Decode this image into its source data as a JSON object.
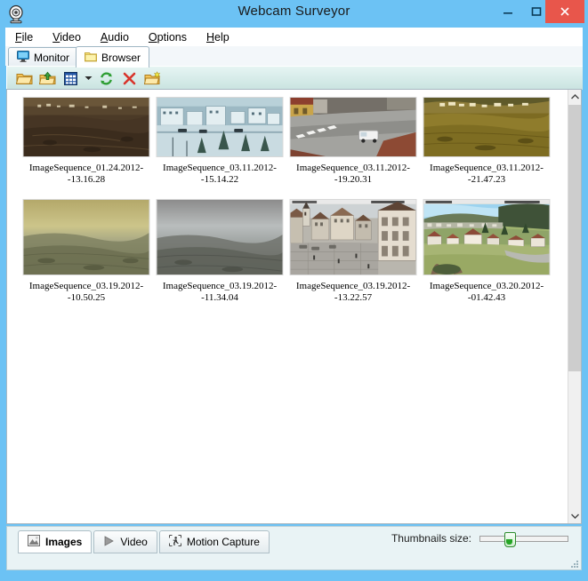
{
  "window": {
    "title": "Webcam Surveyor",
    "app_icon": "webcam-icon",
    "titlebar_color": "#6cc2f4",
    "controls": {
      "minimize": "minimize-icon",
      "maximize": "maximize-icon",
      "close": "close-icon",
      "close_color": "#e8564b"
    }
  },
  "menubar": {
    "items": [
      {
        "label": "File",
        "accel": "F"
      },
      {
        "label": "Video",
        "accel": "V"
      },
      {
        "label": "Audio",
        "accel": "A"
      },
      {
        "label": "Options",
        "accel": "O"
      },
      {
        "label": "Help",
        "accel": "H"
      }
    ]
  },
  "top_tabs": [
    {
      "label": "Monitor",
      "icon": "monitor-icon",
      "active": false
    },
    {
      "label": "Browser",
      "icon": "folder-icon",
      "active": true
    }
  ],
  "toolbar": {
    "buttons": [
      {
        "name": "open-folder-button",
        "icon": "open-folder-icon"
      },
      {
        "name": "upload-folder-button",
        "icon": "folder-up-arrow-icon"
      },
      {
        "name": "view-mode-button",
        "icon": "grid-view-icon"
      },
      {
        "name": "view-mode-dropdown",
        "icon": "chevron-down-icon"
      },
      {
        "name": "refresh-button",
        "icon": "refresh-icon"
      },
      {
        "name": "delete-button",
        "icon": "red-x-icon"
      },
      {
        "name": "new-folder-button",
        "icon": "new-folder-icon"
      }
    ]
  },
  "thumbnails": {
    "rows": [
      [
        {
          "label": "ImageSequence_01.24.2012--13.16.28",
          "scene": "hillside-town-dusk"
        },
        {
          "label": "ImageSequence_03.11.2012--15.14.22",
          "scene": "snowy-village-blue"
        },
        {
          "label": "ImageSequence_03.11.2012--19.20.31",
          "scene": "street-with-white-van"
        },
        {
          "label": "ImageSequence_03.11.2012--21.47.23",
          "scene": "golden-hillside-village"
        }
      ],
      [
        {
          "label": "ImageSequence_03.19.2012--10.50.25",
          "scene": "hazy-olive-valley"
        },
        {
          "label": "ImageSequence_03.19.2012--11.34.04",
          "scene": "grey-foggy-valley"
        },
        {
          "label": "ImageSequence_03.19.2012--13.22.57",
          "scene": "town-square-church"
        },
        {
          "label": "ImageSequence_03.20.2012--01.42.43",
          "scene": "village-valley-blue-sky"
        }
      ]
    ]
  },
  "scrollbar": {
    "vertical": {
      "up_icon": "chevron-up-icon",
      "down_icon": "chevron-down-icon",
      "thumb_position": "top"
    }
  },
  "bottom_tabs": [
    {
      "label": "Images",
      "icon": "picture-icon",
      "active": true
    },
    {
      "label": "Video",
      "icon": "play-triangle-icon",
      "active": false
    },
    {
      "label": "Motion Capture",
      "icon": "running-person-icon",
      "active": false
    }
  ],
  "thumbnail_size": {
    "label": "Thumbnails size:",
    "value_percent": 28,
    "thumb_color": "#25a525"
  }
}
